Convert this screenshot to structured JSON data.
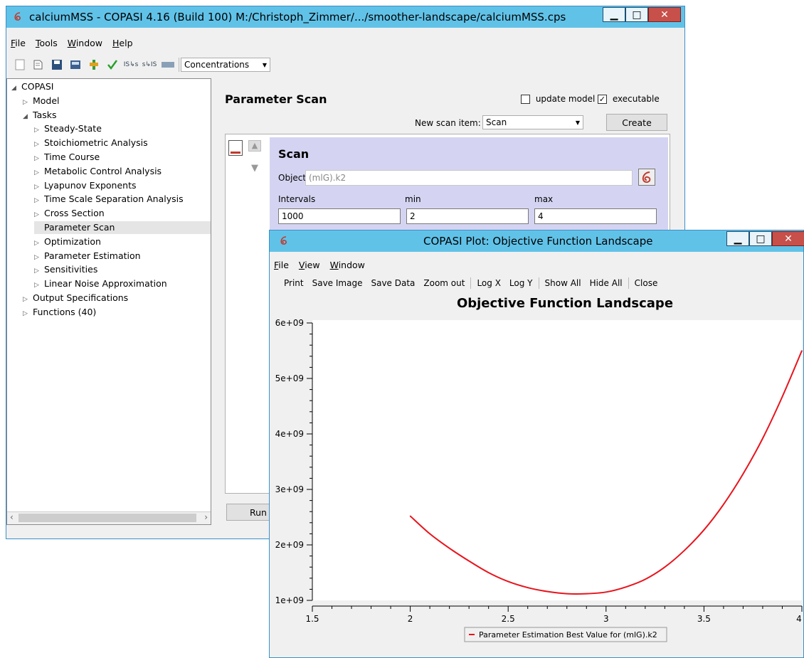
{
  "main_window": {
    "title": "calciumMSS - COPASI 4.16 (Build 100) M:/Christoph_Zimmer/.../smoother-landscape/calciumMSS.cps",
    "menu": [
      "File",
      "Tools",
      "Window",
      "Help"
    ],
    "toolbar": {
      "units_select": "Concentrations"
    },
    "tree": [
      {
        "label": "COPASI",
        "level": 0,
        "state": "open"
      },
      {
        "label": "Model",
        "level": 1,
        "state": "closed"
      },
      {
        "label": "Tasks",
        "level": 1,
        "state": "open"
      },
      {
        "label": "Steady-State",
        "level": 2,
        "state": "closed"
      },
      {
        "label": "Stoichiometric Analysis",
        "level": 2,
        "state": "closed"
      },
      {
        "label": "Time Course",
        "level": 2,
        "state": "closed"
      },
      {
        "label": "Metabolic Control Analysis",
        "level": 2,
        "state": "closed"
      },
      {
        "label": "Lyapunov Exponents",
        "level": 2,
        "state": "closed"
      },
      {
        "label": "Time Scale Separation Analysis",
        "level": 2,
        "state": "closed"
      },
      {
        "label": "Cross Section",
        "level": 2,
        "state": "closed"
      },
      {
        "label": "Parameter Scan",
        "level": 2,
        "state": "leaf",
        "selected": true
      },
      {
        "label": "Optimization",
        "level": 2,
        "state": "closed"
      },
      {
        "label": "Parameter Estimation",
        "level": 2,
        "state": "closed"
      },
      {
        "label": "Sensitivities",
        "level": 2,
        "state": "closed"
      },
      {
        "label": "Linear Noise Approximation",
        "level": 2,
        "state": "closed"
      },
      {
        "label": "Output Specifications",
        "level": 1,
        "state": "closed"
      },
      {
        "label": "Functions (40)",
        "level": 1,
        "state": "closed"
      }
    ],
    "panel": {
      "heading": "Parameter Scan",
      "update_model_label": "update model",
      "update_model_checked": false,
      "executable_label": "executable",
      "executable_checked": true,
      "new_scan_item_label": "New scan item:",
      "new_scan_item_value": "Scan",
      "create_button": "Create",
      "scan": {
        "heading": "Scan",
        "object_label": "Object",
        "object_value": "(mlG).k2",
        "intervals_label": "Intervals",
        "min_label": "min",
        "max_label": "max",
        "intervals_value": "1000",
        "min_value": "2",
        "max_value": "4"
      },
      "run_button": "Run"
    }
  },
  "plot_window": {
    "title": "COPASI Plot: Objective Function Landscape",
    "menu": [
      "File",
      "View",
      "Window"
    ],
    "toolbar": [
      "Print",
      "Save Image",
      "Save Data",
      "Zoom out",
      "Log X",
      "Log Y",
      "Show All",
      "Hide All",
      "Close"
    ]
  },
  "chart_data": {
    "type": "line",
    "title": "Objective Function Landscape",
    "xlabel": "",
    "ylabel": "",
    "xlim": [
      1.5,
      4
    ],
    "ylim": [
      1000000000.0,
      6000000000.0
    ],
    "x_ticks": [
      "1.5",
      "2",
      "2.5",
      "3",
      "3.5",
      "4"
    ],
    "y_ticks": [
      "1e+09",
      "2e+09",
      "3e+09",
      "4e+09",
      "5e+09",
      "6e+09"
    ],
    "grid": false,
    "legend_position": "bottom",
    "color": "#e8141c",
    "series": [
      {
        "name": "Parameter Estimation Best Value for (mlG).k2",
        "x": [
          2.0,
          2.1,
          2.2,
          2.3,
          2.4,
          2.5,
          2.6,
          2.7,
          2.8,
          2.9,
          3.0,
          3.1,
          3.2,
          3.3,
          3.4,
          3.5,
          3.6,
          3.7,
          3.8,
          3.9,
          4.0
        ],
        "values": [
          2520000000.0,
          2200000000.0,
          1940000000.0,
          1710000000.0,
          1500000000.0,
          1340000000.0,
          1230000000.0,
          1160000000.0,
          1120000000.0,
          1120000000.0,
          1150000000.0,
          1240000000.0,
          1380000000.0,
          1600000000.0,
          1900000000.0,
          2270000000.0,
          2730000000.0,
          3280000000.0,
          3920000000.0,
          4670000000.0,
          5500000000.0
        ]
      }
    ]
  }
}
